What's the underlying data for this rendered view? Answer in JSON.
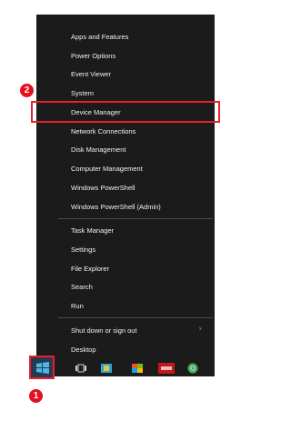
{
  "menu": {
    "groups": [
      [
        "Apps and Features",
        "Power Options",
        "Event Viewer",
        "System",
        "Device Manager",
        "Network Connections",
        "Disk Management",
        "Computer Management",
        "Windows PowerShell",
        "Windows PowerShell (Admin)"
      ],
      [
        "Task Manager",
        "Settings",
        "File Explorer",
        "Search",
        "Run"
      ],
      [
        "Shut down or sign out",
        "Desktop"
      ]
    ],
    "highlighted_item": "Device Manager"
  },
  "callouts": {
    "step1": "1",
    "step2": "2"
  },
  "taskbar": {
    "icons": [
      "windows-start-icon",
      "task-view-icon",
      "store-icon",
      "photos-icon",
      "flash-app-icon",
      "chrome-icon"
    ]
  },
  "colors": {
    "menu_bg": "#1b1b1b",
    "menu_text": "#f2f2f2",
    "highlight_border": "#e8202a",
    "callout_bg": "#e4101f"
  }
}
